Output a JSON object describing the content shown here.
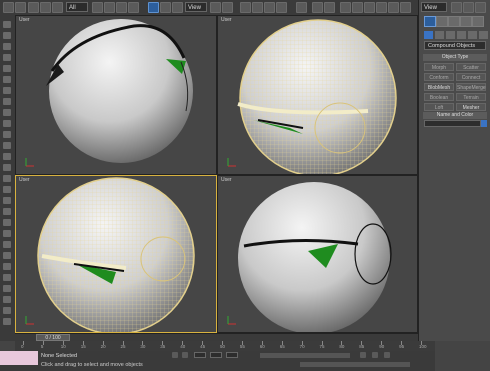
{
  "toolbar": {
    "selection_filter": "All",
    "view_dropdown": "View",
    "panel_dropdown": "View"
  },
  "viewports": [
    {
      "label": "User"
    },
    {
      "label": "User"
    },
    {
      "label": "User"
    },
    {
      "label": "User"
    }
  ],
  "command_panel": {
    "category": "Compound Objects",
    "object_type_title": "Object Type",
    "buttons": [
      "Morph",
      "Scatter",
      "Conform",
      "Connect",
      "BlobMesh",
      "ShapeMerge",
      "Boolean",
      "Terrain",
      "Loft",
      "Mesher",
      "ProBoolean",
      "ProCutter"
    ],
    "name_and_color_title": "Name and Color"
  },
  "timeslider": {
    "frame": "0 / 100"
  },
  "track_numbers": [
    "0",
    "5",
    "10",
    "15",
    "20",
    "25",
    "30",
    "35",
    "40",
    "45",
    "50",
    "55",
    "60",
    "65",
    "70",
    "75",
    "80",
    "85",
    "90",
    "95",
    "100"
  ],
  "status": {
    "selection": "None Selected",
    "prompt": "Click and drag to select and move objects"
  },
  "colors": {
    "accent": "#2c5e9c",
    "active_border": "#d8b23f",
    "sphere_wire": "#f0e2b0",
    "green_cut": "#1f8c1f"
  }
}
